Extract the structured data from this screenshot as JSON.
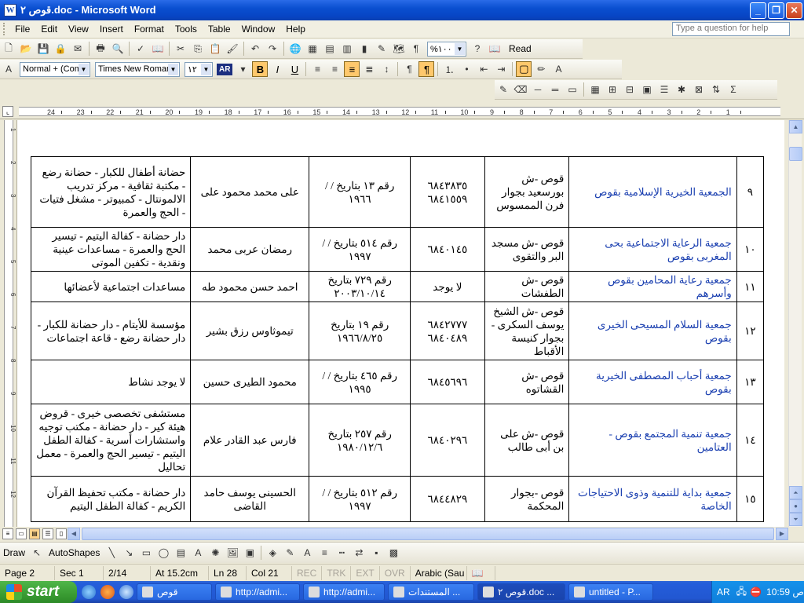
{
  "window": {
    "title": "قوص ٢.doc - Microsoft Word",
    "icon_letter": "W"
  },
  "menu": [
    "File",
    "Edit",
    "View",
    "Insert",
    "Format",
    "Tools",
    "Table",
    "Window",
    "Help"
  ],
  "help_placeholder": "Type a question for help",
  "standard_toolbar": {
    "zoom": "%١٠٠",
    "read_label": "Read"
  },
  "formatting_toolbar": {
    "style": "Normal + (Com",
    "font": "Times New Roman",
    "size": "١٢",
    "lang_button": "AR",
    "bold": "B",
    "italic": "I",
    "underline": "U"
  },
  "ruler_numbers": [
    "24",
    "23",
    "22",
    "21",
    "20",
    "19",
    "18",
    "17",
    "16",
    "15",
    "14",
    "13",
    "12",
    "11",
    "10",
    "9",
    "8",
    "7",
    "6",
    "5",
    "4",
    "3",
    "2",
    "1"
  ],
  "vruler_numbers": [
    "1",
    "2",
    "3",
    "4",
    "5",
    "6",
    "7",
    "8",
    "9",
    "10",
    "11",
    "12"
  ],
  "table_rows": [
    {
      "idx": "٩",
      "name": "الجمعية الخيرية الإسلامية بقوص",
      "addr": "قوص -ش بورسعيد بجوار فرن الممسوس",
      "phone": "٦٨٤٣٨٣٥ ٦٨٤١٥٥٩",
      "reg": "رقم ١٣ بتاريخ / / ١٩٦٦",
      "head": "على محمد محمود على",
      "act": "حضانة أطفال للكبار - حضانة رضع - مكتبة ثقافية - مركز تدريب الالمونتال - كمبيوتر - مشغل فتيات - الحج والعمرة"
    },
    {
      "idx": "١٠",
      "name": "جمعية الرعاية الاجتماعية بحى المغربى بقوص",
      "addr": "قوص -ش مسجد البر والتقوى",
      "phone": "٦٨٤٠١٤٥",
      "reg": "رقم ٥١٤ بتاريخ / / ١٩٩٧",
      "head": "رمضان عربى محمد",
      "act": "دار حضانة - كفالة اليتيم - تيسير الحج والعمرة - مساعدات عينية ونقدية - تكفين الموتى"
    },
    {
      "idx": "١١",
      "name": "جمعية رعاية المحامين بقوص وأسرهم",
      "addr": "قوص -ش الطفشات",
      "phone": "لا يوجد",
      "reg": "رقم ٧٢٩ بتاريخ ٢٠٠٣/١٠/١٤",
      "head": "احمد حسن محمود طه",
      "act": "مساعدات اجتماعية لأعضائها"
    },
    {
      "idx": "١٢",
      "name": "جمعية السلام المسيحى الخيرى بقوص",
      "addr": "قوص -ش الشيخ يوسف السكرى - بجوار كنيسة الأقباط",
      "phone": "٦٨٤٢٧٧٧ ٦٨٤٠٤٨٩",
      "reg": "رقم ١٩ بتاريخ ١٩٦٦/٨/٢٥",
      "head": "تيموثاوس رزق بشير",
      "act": "مؤسسة للأيتام - دار حضانة للكبار - دار حضانة رضع - قاعة اجتماعات"
    },
    {
      "idx": "١٣",
      "name": "جمعية أحباب المصطفى الخيرية بقوص",
      "addr": "قوص -ش القشاتوه",
      "phone": "٦٨٤٥٦٩٦",
      "reg": "رقم ٤٦٥ بتاريخ / / ١٩٩٥",
      "head": "محمود الطيرى حسين",
      "act": "لا يوجد نشاط"
    },
    {
      "idx": "١٤",
      "name": "جمعية تنمية المجتمع بقوص - العتامين",
      "addr": "قوص -ش على بن أبى طالب",
      "phone": "٦٨٤٠٢٩٦",
      "reg": "رقم ٢٥٧ بتاريخ ١٩٨٠/١٢/٦",
      "head": "فارس عبد القادر علام",
      "act": "مستشفى تخصصى خيرى - قروض هيئة كير - دار حضانة - مكتب توجيه واستشارات أسرية - كفالة الطفل اليتيم - تيسير الحج والعمرة - معمل تحاليل"
    },
    {
      "idx": "١٥",
      "name": "جمعية بداية للتنمية وذوى الاحتياجات الخاصة",
      "addr": "قوص -بجوار المحكمة",
      "phone": "٦٨٤٤٨٢٩",
      "reg": "رقم ٥١٢ بتاريخ / / ١٩٩٧",
      "head": "الحسينى يوسف حامد القاضى",
      "act": "دار حضانة - مكتب تحفيظ القرآن الكريم - كفالة الطفل اليتيم"
    }
  ],
  "drawing_toolbar": {
    "draw": "Draw",
    "autoshapes": "AutoShapes"
  },
  "status": {
    "page": "Page 2",
    "sec": "Sec 1",
    "pages": "2/14",
    "at": "At 15.2cm",
    "ln": "Ln 28",
    "col": "Col 21",
    "rec": "REC",
    "trk": "TRK",
    "ext": "EXT",
    "ovr": "OVR",
    "language": "Arabic (Sau"
  },
  "taskbar": {
    "start": "start",
    "tasks": [
      {
        "label": "قوص",
        "active": false
      },
      {
        "label": "http://admi...",
        "active": false
      },
      {
        "label": "http://admi...",
        "active": false
      },
      {
        "label": "المستندات ...",
        "active": false
      },
      {
        "label": "قوص ٢.doc ...",
        "active": true
      },
      {
        "label": "untitled - P...",
        "active": false
      }
    ],
    "lang": "AR",
    "clock": "10:59 ص"
  }
}
